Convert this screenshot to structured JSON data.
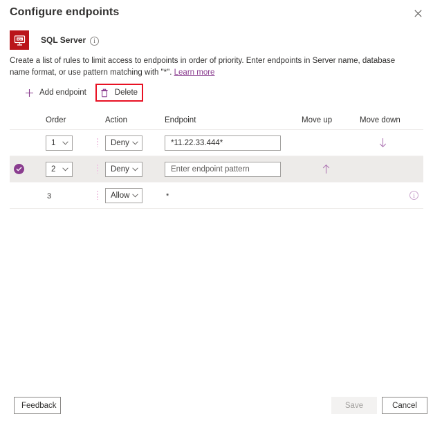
{
  "panel": {
    "title": "Configure endpoints",
    "close_icon": "close-icon"
  },
  "resource": {
    "icon": "sql-server-icon",
    "name": "SQL Server",
    "info_icon": "info-icon",
    "info_glyph": "i"
  },
  "description": {
    "text_before_link": "Create a list of rules to limit access to endpoints in order of priority. Enter endpoints in Server name, database name format, or use pattern matching with \"*\". ",
    "link_label": "Learn more"
  },
  "command_bar": {
    "add_endpoint_label": "Add endpoint",
    "add_icon": "plus-icon",
    "delete_label": "Delete",
    "delete_icon": "trash-icon",
    "delete_highlight_color": "#e81123"
  },
  "grid": {
    "columns": [
      {
        "key": "order",
        "label": "Order"
      },
      {
        "key": "action",
        "label": "Action"
      },
      {
        "key": "endpoint",
        "label": "Endpoint"
      },
      {
        "key": "move_up",
        "label": "Move up"
      },
      {
        "key": "move_down",
        "label": "Move down"
      }
    ],
    "rows": [
      {
        "selected": false,
        "order": "1",
        "action": "Deny",
        "endpoint_value": "*11.22.33.444*",
        "endpoint_placeholder": "Enter endpoint pattern",
        "move_up": false,
        "move_down": true,
        "info": false
      },
      {
        "selected": true,
        "order": "2",
        "action": "Deny",
        "endpoint_value": "",
        "endpoint_placeholder": "Enter endpoint pattern",
        "move_up": true,
        "move_down": false,
        "info": false
      },
      {
        "selected": false,
        "order": "3",
        "action": "Allow",
        "endpoint_value": "*",
        "endpoint_placeholder": "",
        "move_up": false,
        "move_down": false,
        "info": true
      }
    ]
  },
  "footer": {
    "feedback_label": "Feedback",
    "save_label": "Save",
    "save_disabled": true,
    "cancel_label": "Cancel"
  },
  "colors": {
    "accent": "#8a3d8f",
    "brand_red": "#ba141a",
    "highlight_red": "#e81123",
    "selected_row": "#edebe9"
  }
}
